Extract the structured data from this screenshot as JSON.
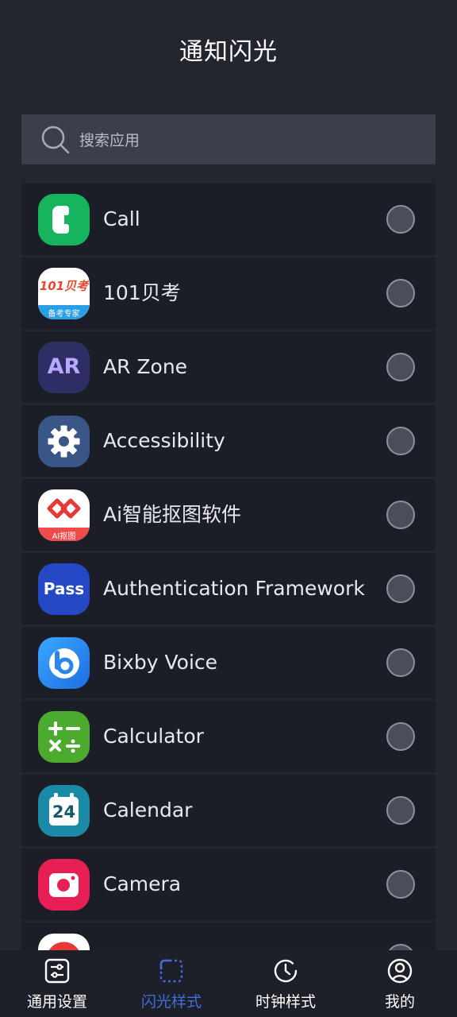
{
  "header": {
    "title": "通知闪光"
  },
  "search": {
    "placeholder": "搜索应用"
  },
  "apps": [
    {
      "name": "Call",
      "icon": "phone-icon"
    },
    {
      "name": "101贝考",
      "icon": "101beikao-icon",
      "icon_text": "101贝考",
      "icon_subtext": "备考专家"
    },
    {
      "name": "AR Zone",
      "icon": "ar-zone-icon",
      "icon_text": "AR"
    },
    {
      "name": "Accessibility",
      "icon": "gear-icon"
    },
    {
      "name": "Ai智能抠图软件",
      "icon": "ai-cutout-icon",
      "icon_subtext": "AI抠图"
    },
    {
      "name": "Authentication Framework",
      "icon": "pass-icon",
      "icon_text": "Pass"
    },
    {
      "name": "Bixby Voice",
      "icon": "bixby-icon"
    },
    {
      "name": "Calculator",
      "icon": "calculator-icon"
    },
    {
      "name": "Calendar",
      "icon": "calendar-icon",
      "icon_text": "24"
    },
    {
      "name": "Camera",
      "icon": "camera-icon"
    }
  ],
  "tabs": [
    {
      "label": "通用设置",
      "icon": "sliders-icon",
      "active": false
    },
    {
      "label": "闪光样式",
      "icon": "flash-frame-icon",
      "active": true
    },
    {
      "label": "时钟样式",
      "icon": "clock-icon",
      "active": false
    },
    {
      "label": "我的",
      "icon": "user-icon",
      "active": false
    }
  ]
}
